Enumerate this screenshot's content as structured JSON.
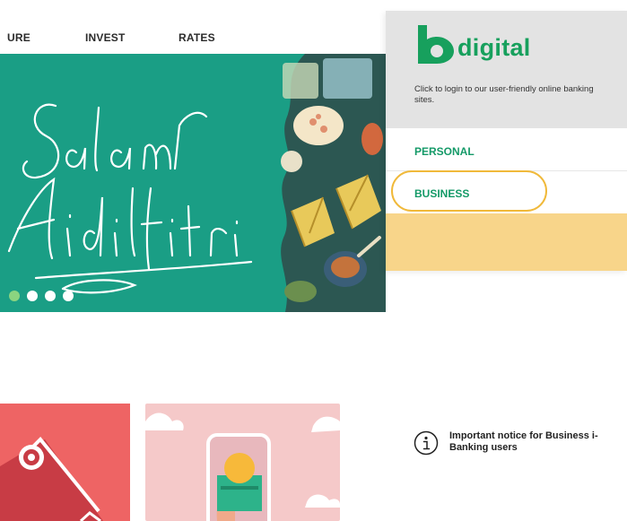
{
  "nav": {
    "items": [
      {
        "label": "URE"
      },
      {
        "label": "INVEST"
      },
      {
        "label": "RATES"
      }
    ]
  },
  "hero": {
    "slide_count": 4,
    "active_slide": 1,
    "script_text": "Salam Aidilfitri"
  },
  "panel": {
    "logo_text": "digital",
    "description": "Click to login to our user-friendly online banking sites.",
    "menu": {
      "personal": "PERSONAL",
      "business": "BUSINESS"
    },
    "notice": {
      "icon": "info-icon",
      "text": "Important notice for Business i-Banking users"
    }
  },
  "colors": {
    "brand_green": "#17a05d",
    "hero_teal": "#1a9e85",
    "notice_yellow": "#f8d58a",
    "highlight_ring": "#f0b93a"
  }
}
